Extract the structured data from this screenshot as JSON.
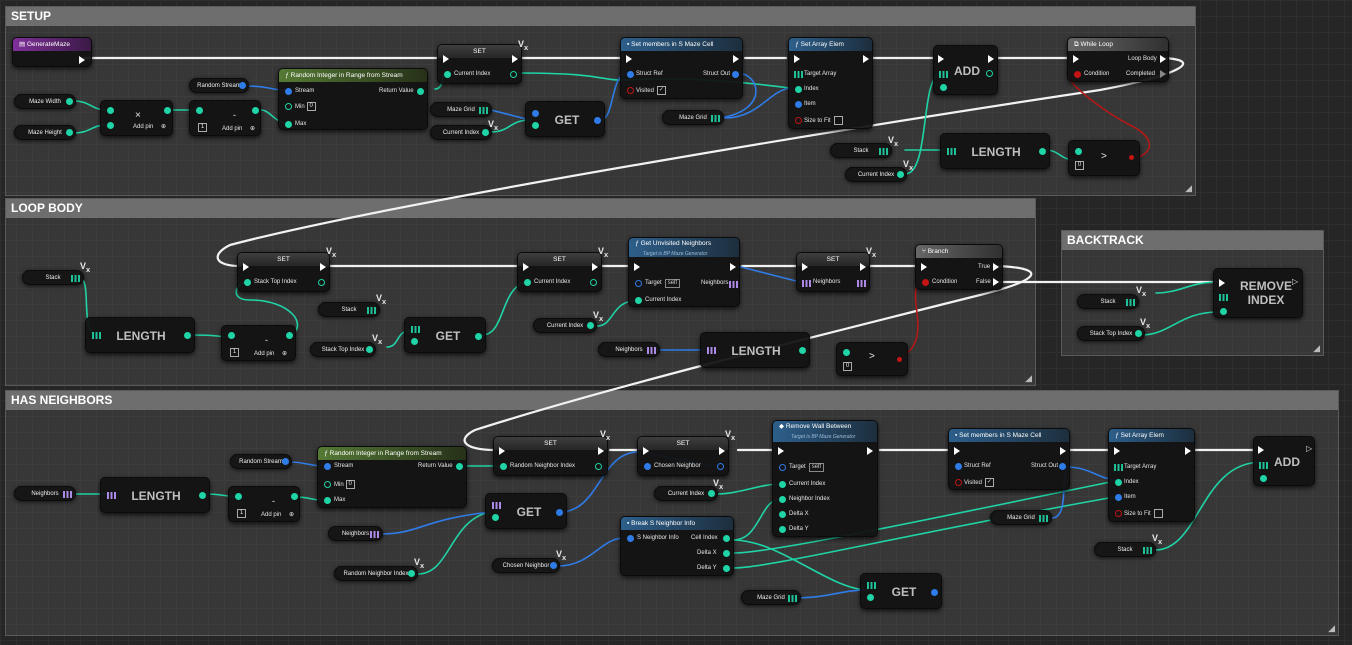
{
  "comments": {
    "setup": "SETUP",
    "loop_body": "LOOP BODY",
    "backtrack": "BACKTRACK",
    "has_neighbors": "HAS NEIGHBORS"
  },
  "common": {
    "set": "SET",
    "get": "GET",
    "length": "LENGTH",
    "add": "ADD",
    "remove_index": "REMOVE\nINDEX",
    "add_pin": "Add pin",
    "minus": "-",
    "times": "×",
    "gt": ">",
    "one": "1",
    "zero": "0",
    "min_val": "0",
    "self": "self",
    "check": "✓",
    "fn_glyph": "ƒ"
  },
  "setup": {
    "event": "GenerateMaze",
    "maze_width": "Maze Width",
    "maze_height": "Maze Height",
    "random_stream": "Random Stream",
    "rand_node": {
      "title": "Random Integer in Range from Stream",
      "stream": "Stream",
      "min": "Min",
      "max": "Max",
      "return": "Return Value"
    },
    "set_current_index": "Current Index",
    "maze_grid": "Maze Grid",
    "current_index": "Current Index",
    "set_members": {
      "title": "Set members in S Maze Cell",
      "struct_ref": "Struct Ref",
      "struct_out": "Struct Out",
      "visited": "Visited"
    },
    "maze_grid2": "Maze Grid",
    "set_array_elem": {
      "title": "Set Array Elem",
      "target_array": "Target Array",
      "index": "Index",
      "item": "Item",
      "size_to_fit": "Size to Fit"
    },
    "stack": "Stack",
    "current_index2": "Current Index",
    "while_loop": {
      "title": "While Loop",
      "condition": "Condition",
      "loop_body": "Loop Body",
      "completed": "Completed"
    }
  },
  "loop_body": {
    "stack": "Stack",
    "set_stack_top": "Stack Top Index",
    "stack2": "Stack",
    "stack_top_index": "Stack Top Index",
    "set_current": "Current Index",
    "current_index": "Current Index",
    "get_unvisited": {
      "title": "Get Unvisited Neighbors",
      "subtitle": "Target is BP Maze Generator",
      "target": "Target",
      "current_index": "Current Index",
      "neighbors": "Neighbors"
    },
    "set_neighbors": "Neighbors",
    "neighbors": "Neighbors",
    "branch": {
      "title": "Branch",
      "condition": "Condition",
      "true": "True",
      "false": "False"
    }
  },
  "backtrack": {
    "stack": "Stack",
    "stack_top_index": "Stack Top Index"
  },
  "has_neighbors": {
    "random_stream": "Random Stream",
    "neighbors": "Neighbors",
    "rand_node": {
      "title": "Random Integer in Range from Stream",
      "stream": "Stream",
      "min": "Min",
      "max": "Max",
      "return": "Return Value"
    },
    "set_random_neighbor": "Random Neighbor Index",
    "neighbors2": "Neighbors",
    "random_neighbor_index": "Random Neighbor Index",
    "set_chosen": "Chosen Neighbor",
    "current_index": "Current Index",
    "chosen_neighbor": "Chosen Neighbor",
    "break_info": {
      "title": "Break S Neighbor Info",
      "s_neighbor_info": "S Neighbor Info",
      "cell_index": "Cell Index",
      "delta_x": "Delta X",
      "delta_y": "Delta Y"
    },
    "remove_wall": {
      "title": "Remove Wall Between",
      "subtitle": "Target is BP Maze Generator",
      "target": "Target",
      "current_index": "Current Index",
      "neighbor_index": "Neighbor Index",
      "delta_x": "Delta X",
      "delta_y": "Delta Y"
    },
    "maze_grid": "Maze Grid",
    "set_members": {
      "title": "Set members in S Maze Cell",
      "struct_ref": "Struct Ref",
      "struct_out": "Struct Out",
      "visited": "Visited"
    },
    "maze_grid2": "Maze Grid",
    "set_array_elem": {
      "title": "Set Array Elem",
      "target_array": "Target Array",
      "index": "Index",
      "item": "Item",
      "size_to_fit": "Size to Fit"
    },
    "stack": "Stack"
  }
}
